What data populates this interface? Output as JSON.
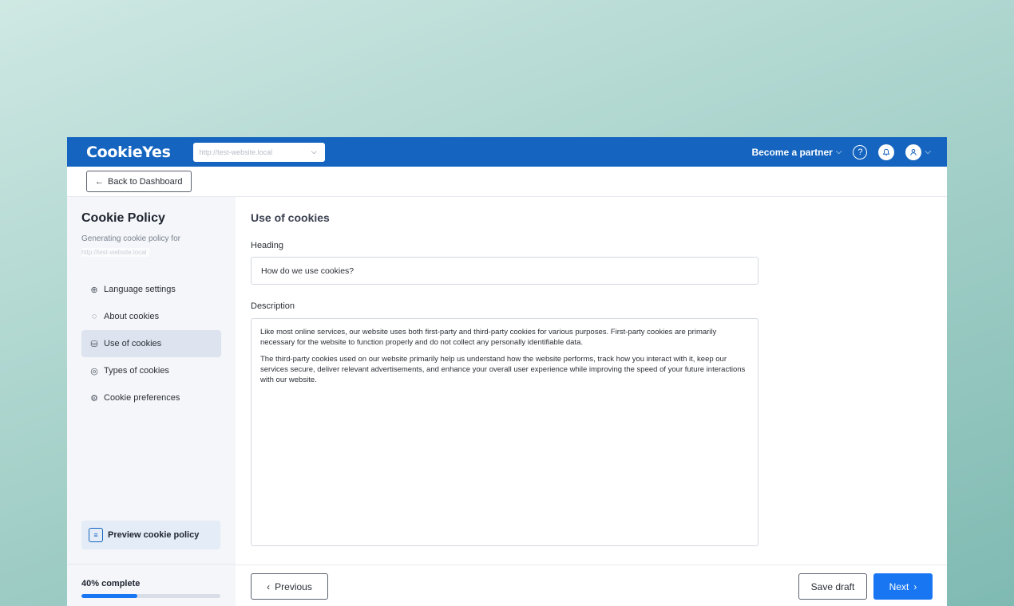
{
  "brand": {
    "logo": "CookieYes",
    "primary": "#1565c0",
    "accent": "#1976f2"
  },
  "topbar": {
    "site_url": "http://test-website.local",
    "partner_label": "Become a partner",
    "help_icon": "?",
    "bell_icon": "bell-icon",
    "user_icon": "user-icon"
  },
  "backbar": {
    "back_label": "Back to Dashboard",
    "arrow": "←"
  },
  "sidebar": {
    "title": "Cookie Policy",
    "subtitle": "Generating cookie policy for",
    "site_url": "http://test-website.local",
    "items": [
      {
        "label": "Language settings",
        "icon": "globe-icon",
        "glyph": "⊕",
        "active": false
      },
      {
        "label": "About cookies",
        "icon": "cookie-icon",
        "glyph": "◌",
        "active": false
      },
      {
        "label": "Use of cookies",
        "icon": "cookies-use-icon",
        "glyph": "⛁",
        "active": true
      },
      {
        "label": "Types of cookies",
        "icon": "types-icon",
        "glyph": "◎",
        "active": false
      },
      {
        "label": "Cookie preferences",
        "icon": "gear-icon",
        "glyph": "⚙",
        "active": false
      }
    ],
    "preview_label": "Preview cookie policy",
    "progress_label": "40% complete",
    "progress_value": 0.4
  },
  "main": {
    "section_title": "Use of cookies",
    "heading_label": "Heading",
    "heading_value": "How do we use cookies?",
    "description_label": "Description",
    "description_paragraphs": [
      "Like most online services, our website uses both first-party and third-party cookies for various purposes. First-party cookies are primarily necessary for the website to function properly and do not collect any personally identifiable data.",
      "The third-party cookies used on our website primarily help us understand how the website performs, track how you interact with it, keep our services secure, deliver relevant advertisements, and enhance your overall user experience while improving the speed of your future interactions with our website."
    ]
  },
  "footer": {
    "previous_label": "Previous",
    "save_draft_label": "Save draft",
    "next_label": "Next"
  }
}
